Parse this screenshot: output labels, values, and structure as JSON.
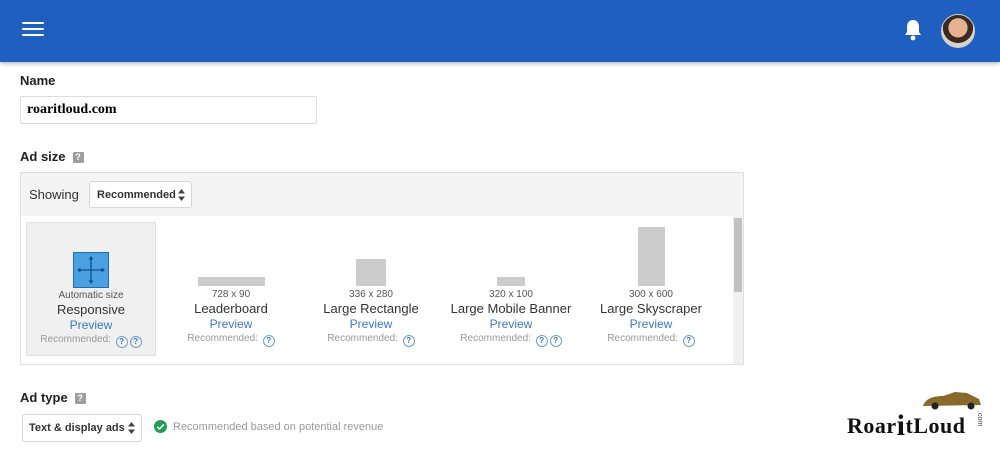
{
  "colors": {
    "header": "#1e5fbf",
    "link": "#3b78c9",
    "success": "#1e9e52",
    "placeholder_box": "#cccccc"
  },
  "header": {
    "menu_icon": "menu-icon",
    "notification_icon": "bell-icon",
    "avatar_icon": "user-avatar"
  },
  "name_field": {
    "label": "Name",
    "value": "roaritloud.com"
  },
  "ad_size": {
    "label": "Ad size",
    "help": "?",
    "showing_label": "Showing",
    "filter_value": "Recommended",
    "sizes": [
      {
        "dims": "Automatic size",
        "title": "Responsive",
        "preview": "Preview",
        "recommended": "Recommended:",
        "help_icons": 2,
        "selected": true
      },
      {
        "dims": "728 x 90",
        "title": "Leaderboard",
        "preview": "Preview",
        "recommended": "Recommended:",
        "help_icons": 1
      },
      {
        "dims": "336 x 280",
        "title": "Large Rectangle",
        "preview": "Preview",
        "recommended": "Recommended:",
        "help_icons": 1
      },
      {
        "dims": "320 x 100",
        "title": "Large Mobile Banner",
        "preview": "Preview",
        "recommended": "Recommended:",
        "help_icons": 2
      },
      {
        "dims": "300 x 600",
        "title": "Large Skyscraper",
        "preview": "Preview",
        "recommended": "Recommended:",
        "help_icons": 1
      }
    ]
  },
  "ad_type": {
    "label": "Ad type",
    "help": "?",
    "value": "Text & display ads",
    "recommendation": "Recommended based on potential revenue"
  },
  "watermark": {
    "text_before": "Roar",
    "text_after": "tLoud",
    "domain": ".com"
  }
}
